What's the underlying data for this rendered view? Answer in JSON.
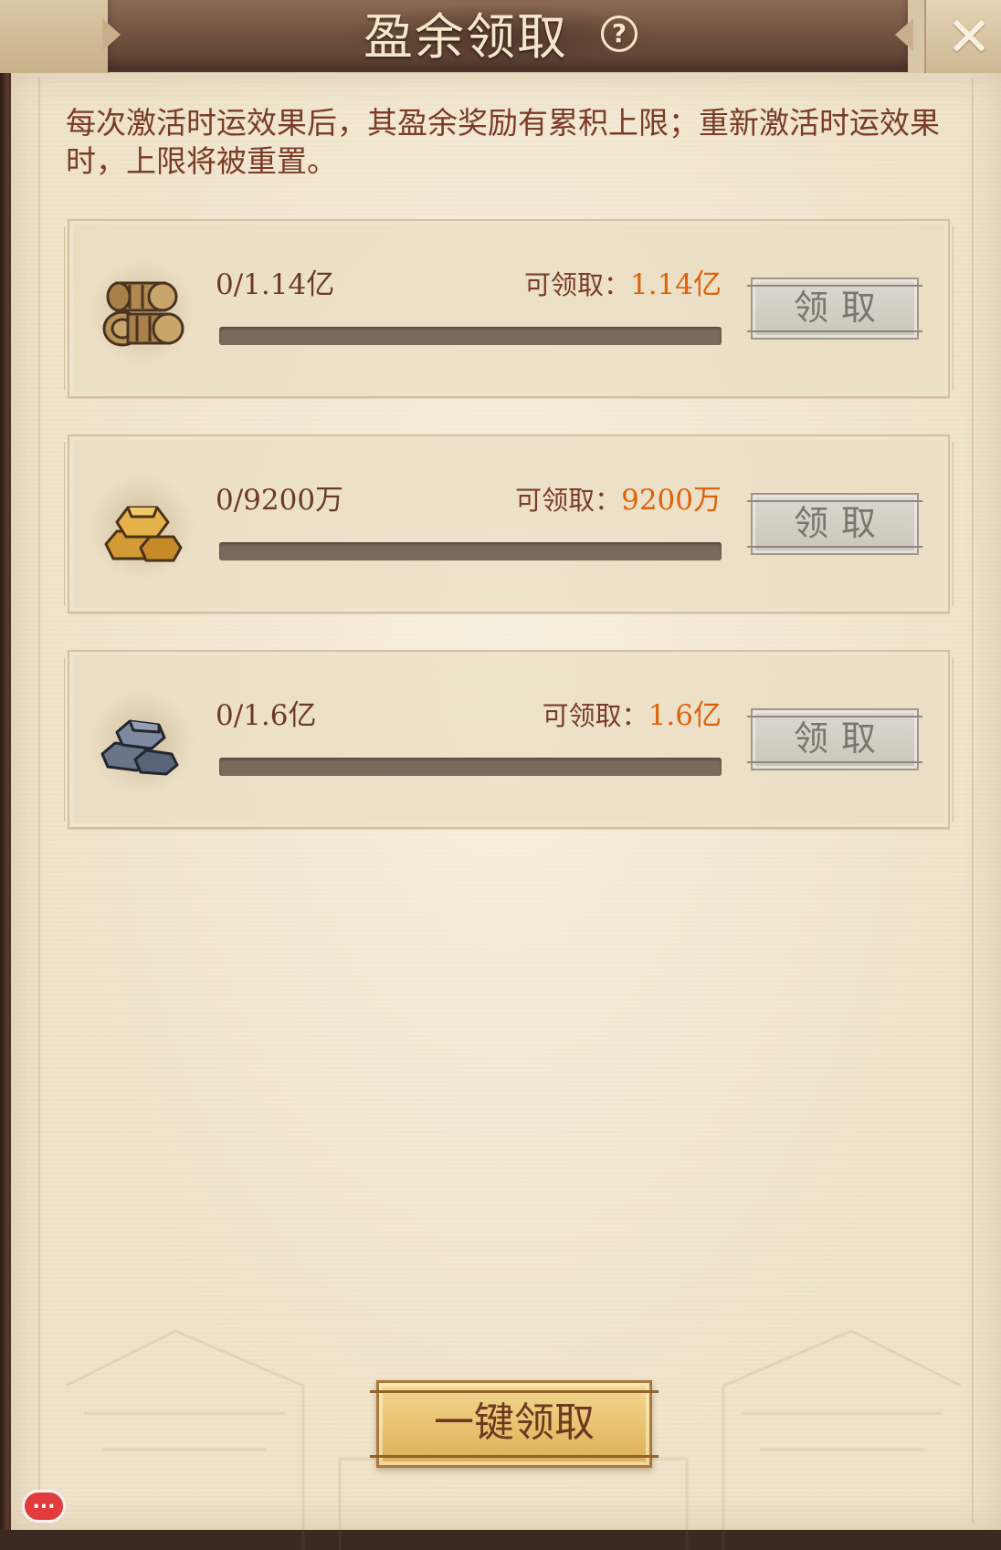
{
  "header": {
    "title": "盈余领取",
    "help_icon": "?",
    "close_icon": "✕"
  },
  "description": "每次激活时运效果后，其盈余奖励有累积上限；重新激活时运效果时，上限将被重置。",
  "claim_label": "可领取：",
  "items": [
    {
      "icon": "grain-bundle-icon",
      "progress_text": "0/1.14亿",
      "claimable": "1.14亿",
      "progress": 0,
      "button": "领取"
    },
    {
      "icon": "gold-ingot-icon",
      "progress_text": "0/9200万",
      "claimable": "9200万",
      "progress": 0,
      "button": "领取"
    },
    {
      "icon": "iron-ingot-icon",
      "progress_text": "0/1.6亿",
      "claimable": "1.6亿",
      "progress": 0,
      "button": "领取"
    }
  ],
  "claim_all_button": "一键领取",
  "chat_bubble": "...",
  "colors": {
    "accent_orange": "#e0620a",
    "text_brown": "#7a3c28",
    "disabled_button": "#cbc5bb",
    "primary_button": "#e6bf6c"
  }
}
